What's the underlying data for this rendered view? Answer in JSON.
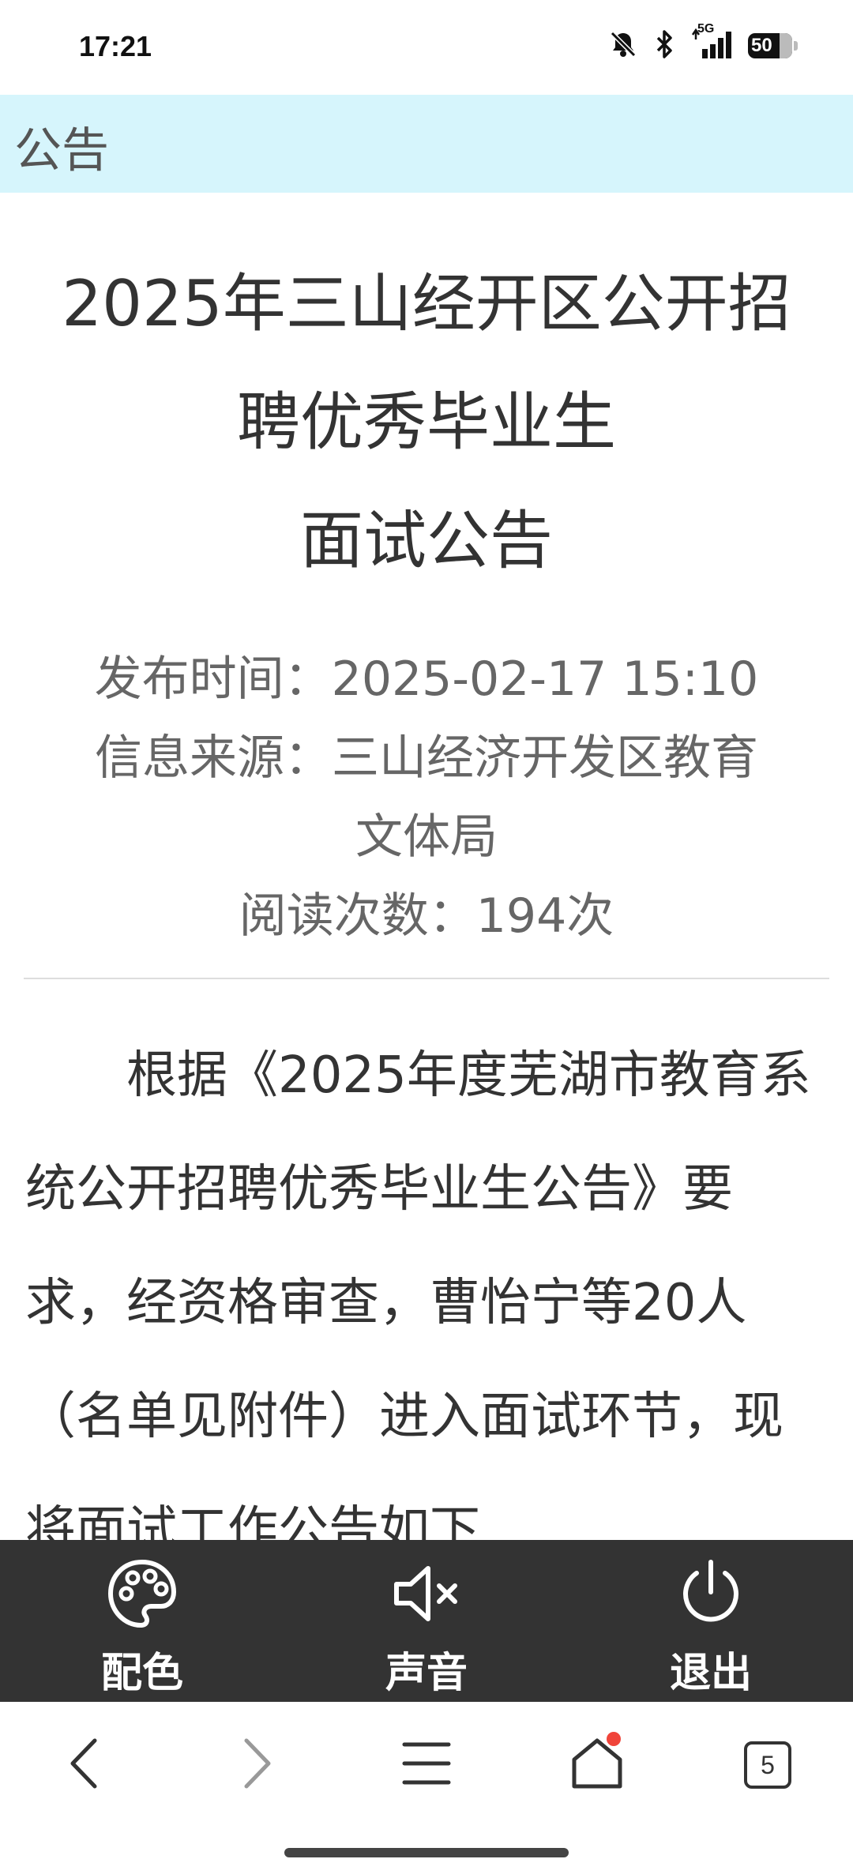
{
  "status_bar": {
    "time": "17:21",
    "network": "5G",
    "battery": "50",
    "icons": [
      "bell-muted-icon",
      "bluetooth-icon",
      "signal-icon",
      "battery-icon"
    ]
  },
  "header": {
    "label": "公告"
  },
  "article": {
    "title_lines": [
      "2025年三山经开区公开招",
      "聘优秀毕业生",
      "面试公告"
    ],
    "publish_time": "发布时间：2025-02-17 15:10",
    "source_line1": "信息来源：三山经济开发区教育",
    "source_line2": "文体局",
    "read_count": "阅读次数：194次",
    "body": "根据《2025年度芜湖市教育系统公开招聘优秀毕业生公告》要求，经资格审查，曹怡宁等20人（名单见附件）进入面试环节，现将面试工作公告如下"
  },
  "toolbar": {
    "color_label": "配色",
    "sound_label": "声音",
    "exit_label": "退出",
    "color_icon": "palette-icon",
    "sound_icon": "speaker-muted-icon",
    "exit_icon": "power-icon"
  },
  "browser_nav": {
    "tab_count": "5",
    "icons": [
      "back-icon",
      "forward-icon",
      "menu-icon",
      "home-icon",
      "tabs-icon"
    ]
  },
  "colors": {
    "header_bg": "#d6f5fc",
    "toolbar_bg": "#333333",
    "notification_dot": "#f0443a"
  }
}
